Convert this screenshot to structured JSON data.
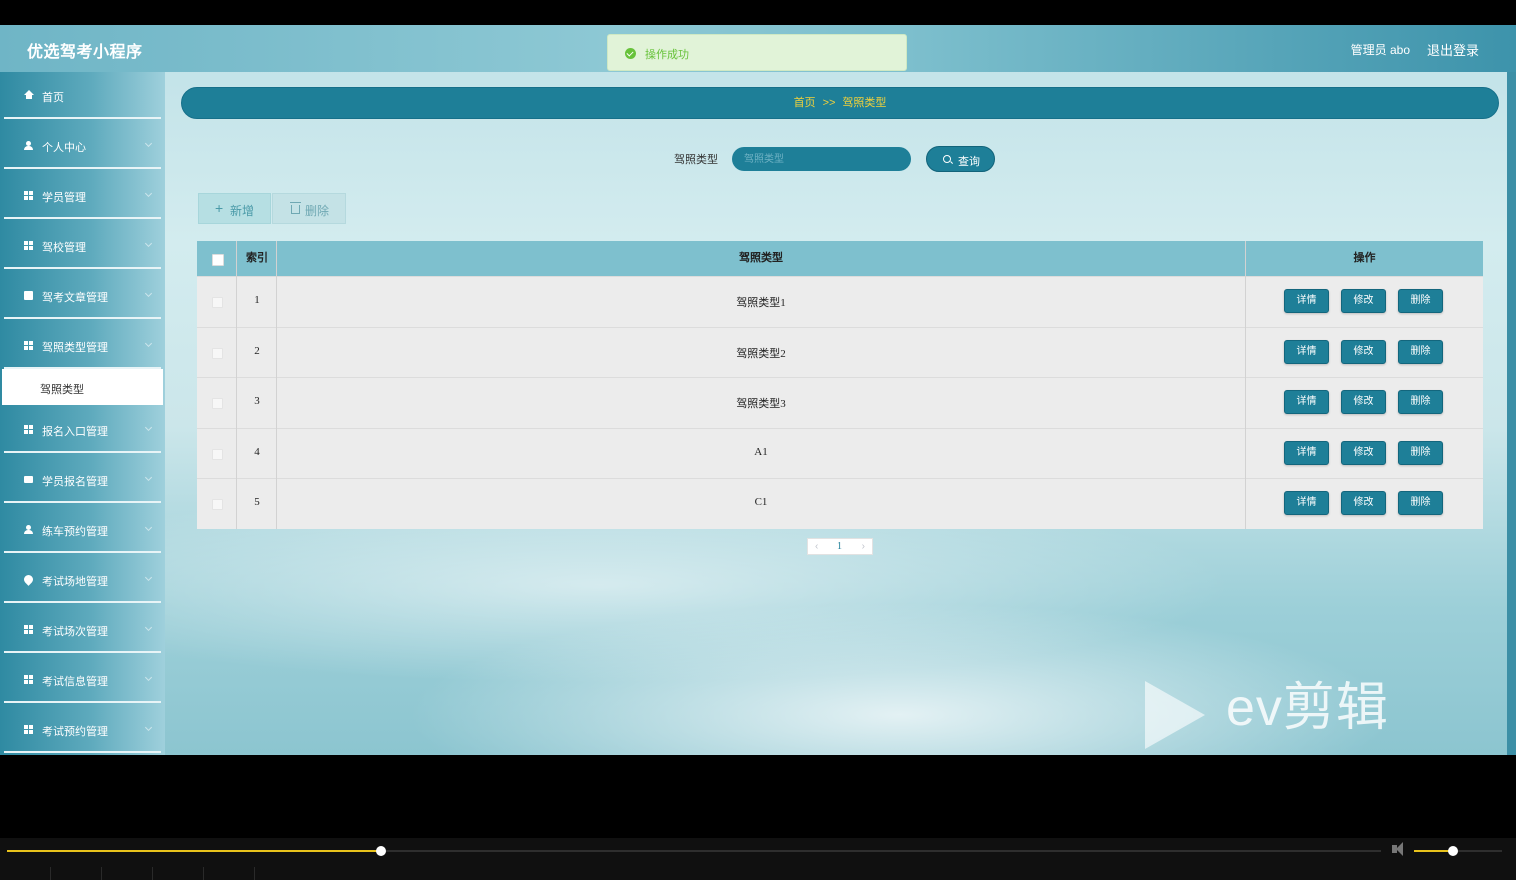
{
  "header": {
    "app_title": "优选驾考小程序",
    "admin_label": "管理员 abo",
    "logout_label": "退出登录"
  },
  "toast": {
    "message": "操作成功",
    "status_color": "#67c23a"
  },
  "sidebar": {
    "items": [
      {
        "label": "首页",
        "icon": "home-icon"
      },
      {
        "label": "个人中心",
        "icon": "user-icon"
      },
      {
        "label": "学员管理",
        "icon": "grid-icon"
      },
      {
        "label": "驾校管理",
        "icon": "grid-icon"
      },
      {
        "label": "驾考文章管理",
        "icon": "clipboard-icon"
      },
      {
        "label": "驾照类型管理",
        "icon": "grid-icon"
      },
      {
        "label": "报名入口管理",
        "icon": "grid-icon"
      },
      {
        "label": "学员报名管理",
        "icon": "briefcase-icon"
      },
      {
        "label": "练车预约管理",
        "icon": "user-icon"
      },
      {
        "label": "考试场地管理",
        "icon": "pin-icon"
      },
      {
        "label": "考试场次管理",
        "icon": "grid-icon"
      },
      {
        "label": "考试信息管理",
        "icon": "grid-icon"
      },
      {
        "label": "考试预约管理",
        "icon": "grid-icon"
      }
    ],
    "active_submenu": "驾照类型"
  },
  "breadcrumb": {
    "home": "首页",
    "separator": ">>",
    "current": "驾照类型"
  },
  "search": {
    "label": "驾照类型",
    "placeholder": "驾照类型",
    "value": "",
    "button_label": "查询"
  },
  "toolbar": {
    "add_label": "新增",
    "delete_label": "删除"
  },
  "table": {
    "columns": {
      "index": "索引",
      "type": "驾照类型",
      "actions": "操作"
    },
    "rows": [
      {
        "index": "1",
        "type": "驾照类型1"
      },
      {
        "index": "2",
        "type": "驾照类型2"
      },
      {
        "index": "3",
        "type": "驾照类型3"
      },
      {
        "index": "4",
        "type": "A1"
      },
      {
        "index": "5",
        "type": "C1"
      }
    ],
    "row_actions": {
      "detail": "详情",
      "edit": "修改",
      "delete": "删除"
    }
  },
  "pagination": {
    "current_page": "1"
  },
  "watermark": {
    "text": "ev剪辑"
  },
  "player": {
    "progress": 0.27,
    "volume": 0.4
  },
  "colors": {
    "primary": "#1e7f98",
    "breadcrumb_text": "#f3d23a",
    "progress": "#e8c21c"
  }
}
